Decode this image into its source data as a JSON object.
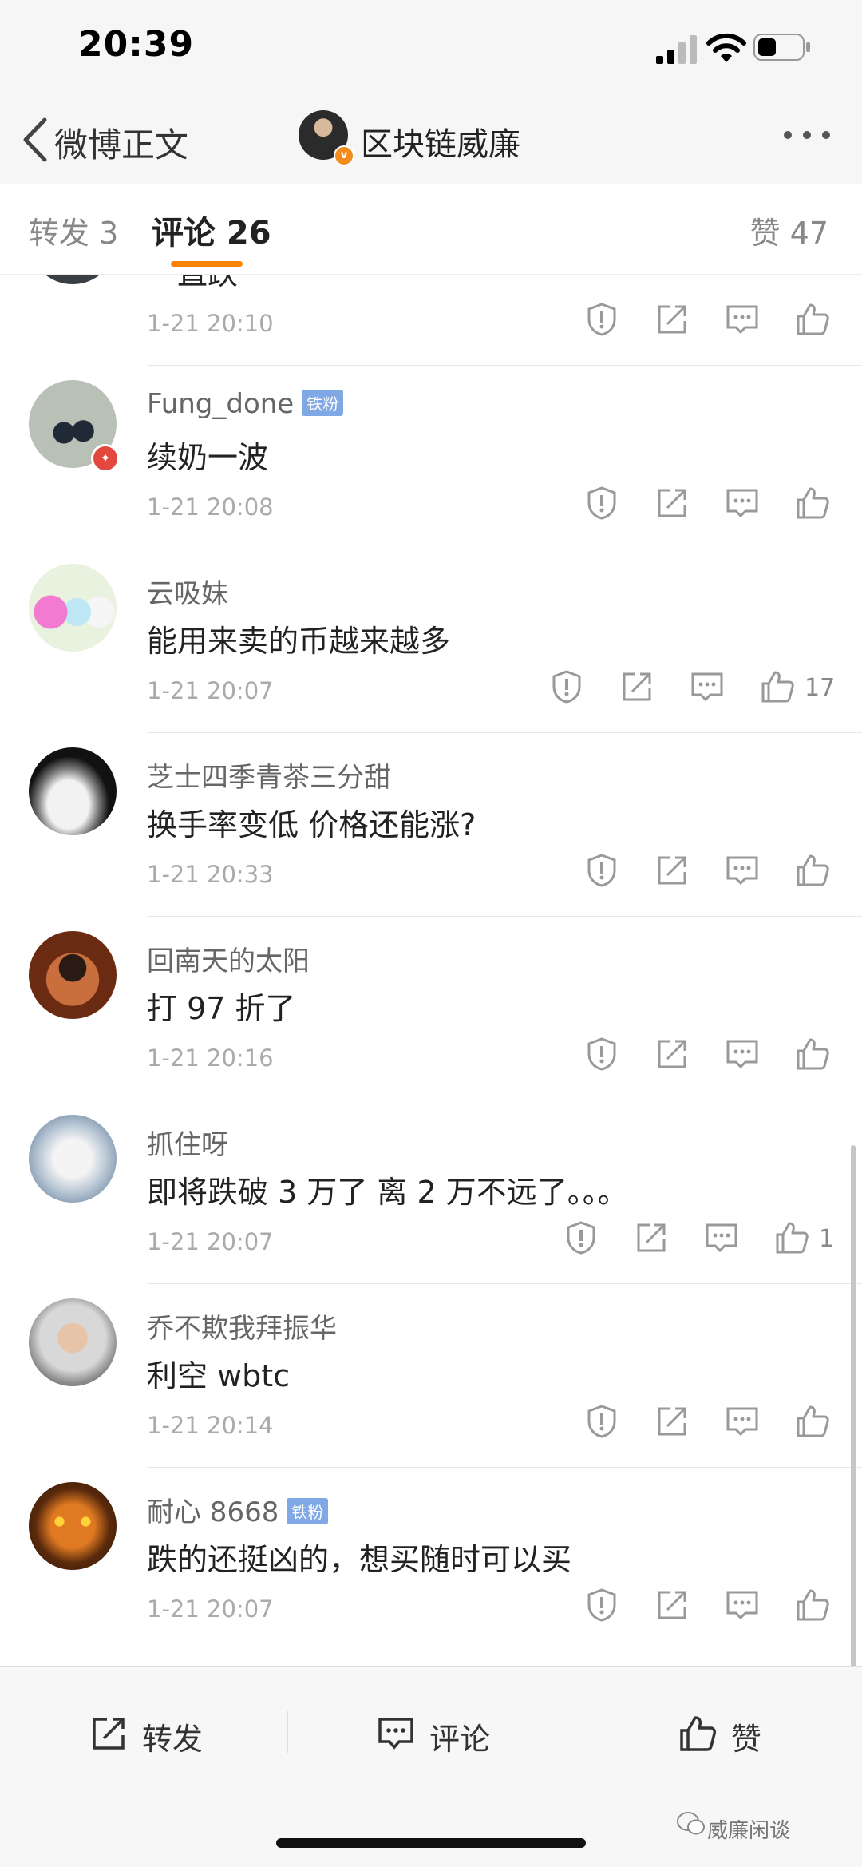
{
  "status_bar": {
    "time": "20:39"
  },
  "nav": {
    "back_label": "微博正文",
    "author_name": "区块链威廉"
  },
  "tabs": {
    "repost": "转发 3",
    "comments": "评论 26",
    "likes": "赞 47"
  },
  "comments": [
    {
      "name": "",
      "badge": "",
      "text": "一直跌",
      "time": "1-21 20:10",
      "likes": ""
    },
    {
      "name": "Fung_done",
      "badge": "铁粉",
      "text": "续奶一波",
      "time": "1-21 20:08",
      "likes": ""
    },
    {
      "name": "云吸妹",
      "badge": "",
      "text": "能用来卖的币越来越多",
      "time": "1-21 20:07",
      "likes": "17"
    },
    {
      "name": "芝士四季青茶三分甜",
      "badge": "",
      "text": "换手率变低 价格还能涨?",
      "time": "1-21 20:33",
      "likes": ""
    },
    {
      "name": "回南天的太阳",
      "badge": "",
      "text": "打 97 折了",
      "time": "1-21 20:16",
      "likes": ""
    },
    {
      "name": "抓住呀",
      "badge": "",
      "text": "即将跌破 3 万了  离 2 万不远了。。。",
      "time": "1-21 20:07",
      "likes": "1"
    },
    {
      "name": "乔不欺我拜振华",
      "badge": "",
      "text": "利空 wbtc",
      "time": "1-21 20:14",
      "likes": ""
    },
    {
      "name": "耐心 8668",
      "badge": "铁粉",
      "text": "跌的还挺凶的，想买随时可以买",
      "time": "1-21 20:07",
      "likes": ""
    }
  ],
  "bottom_bar": {
    "repost": "转发",
    "comment": "评论",
    "like": "赞"
  },
  "watermark": "威廉闲谈",
  "colors": {
    "accent": "#ff8200",
    "badge": "#7fa8e5"
  }
}
